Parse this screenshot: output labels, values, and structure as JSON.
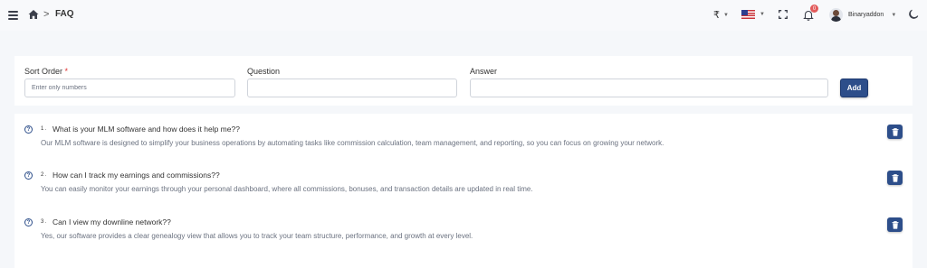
{
  "header": {
    "breadcrumb_separator": ">",
    "page_title": "FAQ",
    "currency_symbol": "₹",
    "notification_count": "0",
    "user_name": "Binaryaddon"
  },
  "form": {
    "sort_order_label": "Sort Order",
    "required_mark": "*",
    "sort_order_placeholder": "Enter only numbers",
    "sort_order_value": "",
    "question_label": "Question",
    "question_value": "",
    "answer_label": "Answer",
    "answer_value": "",
    "add_label": "Add"
  },
  "faqs": [
    {
      "number": "1.",
      "question": "What is your MLM software and how does it help me??",
      "answer": "Our MLM software is designed to simplify your business operations by automating tasks like commission calculation, team management, and reporting, so you can focus on growing your network."
    },
    {
      "number": "2.",
      "question": "How can I track my earnings and commissions??",
      "answer": "You can easily monitor your earnings through your personal dashboard, where all commissions, bonuses, and transaction details are updated in real time."
    },
    {
      "number": "3.",
      "question": "Can I view my downline network??",
      "answer": "Yes, our software provides a clear genealogy view that allows you to track your team structure, performance, and growth at every level."
    }
  ],
  "icons": {
    "menu": "hamburger-icon",
    "home": "home-icon",
    "flag": "us-flag-icon",
    "fullscreen": "fullscreen-icon",
    "notifications": "bell-icon",
    "theme": "moon-icon",
    "question": "question-circle-icon",
    "delete": "trash-icon"
  },
  "colors": {
    "primary": "#2d4e8a",
    "background": "#f5f7fa",
    "required": "#e03131",
    "badge": "#e25b5b",
    "muted_text": "#6b7280"
  }
}
